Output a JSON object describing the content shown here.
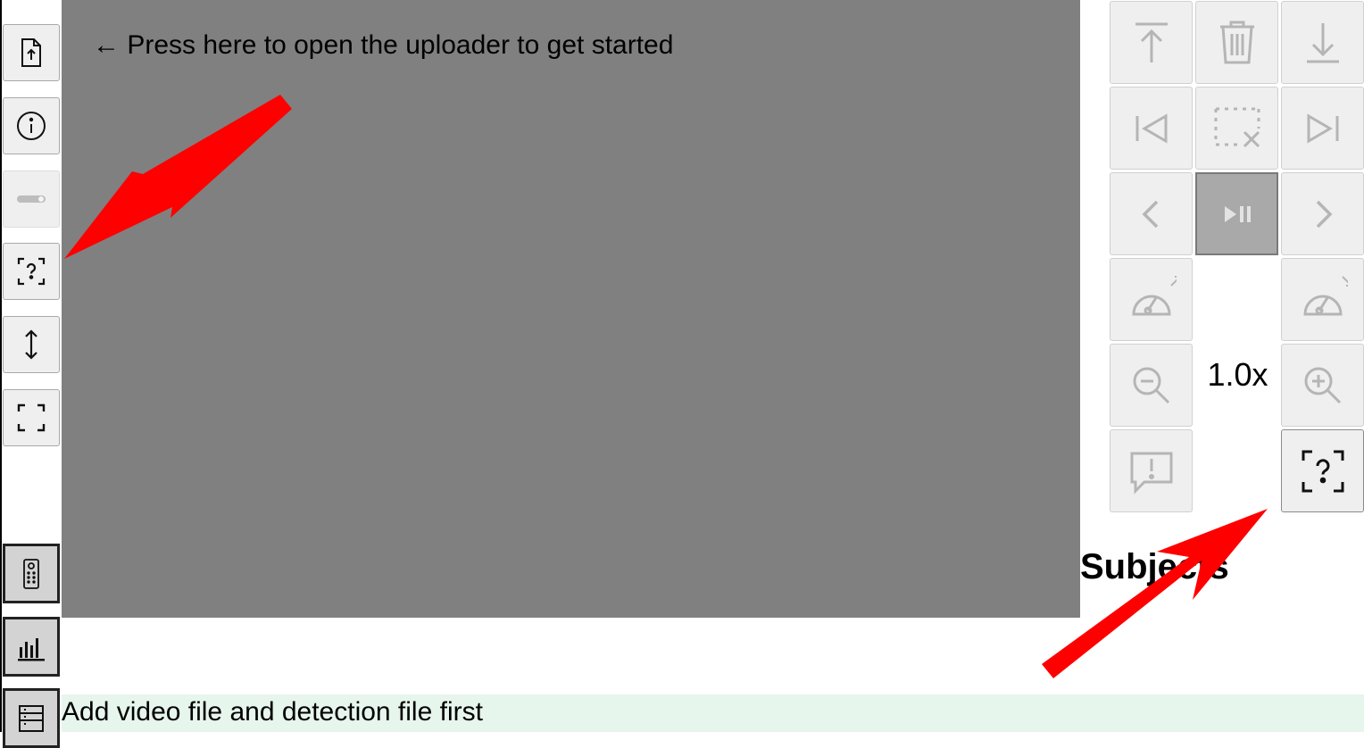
{
  "video": {
    "hint": "← Press here to open the uploader to get started",
    "background": "#808080"
  },
  "sidebar": {
    "buttons": [
      {
        "name": "upload-file-icon",
        "state": "enabled"
      },
      {
        "name": "info-icon",
        "state": "enabled"
      },
      {
        "name": "toggle-icon",
        "state": "disabled"
      },
      {
        "name": "help-region-icon",
        "state": "enabled"
      },
      {
        "name": "vertical-resize-icon",
        "state": "enabled"
      },
      {
        "name": "fullscreen-icon",
        "state": "enabled"
      },
      {
        "name": "remote-control-icon",
        "state": "pressed"
      },
      {
        "name": "bar-chart-icon",
        "state": "pressed"
      },
      {
        "name": "list-panel-icon",
        "state": "pressed"
      }
    ]
  },
  "controls": {
    "zoom_level": "1.0x",
    "buttons": [
      "jump-to-top-icon",
      "delete-icon",
      "download-icon",
      "skip-to-start-icon",
      "clear-selection-icon",
      "skip-to-end-icon",
      "previous-icon",
      "play-pause-icon",
      "next-icon",
      "speed-up-icon",
      "slow-down-icon",
      "zoom-out-icon",
      "zoom-in-icon",
      "report-icon",
      "help-region-icon"
    ]
  },
  "subjects": {
    "heading": "Subjects"
  },
  "status": {
    "message": "Add video file and detection file first"
  },
  "colors": {
    "annotation_arrow": "#ff0000",
    "status_background": "#e7f6ec"
  }
}
